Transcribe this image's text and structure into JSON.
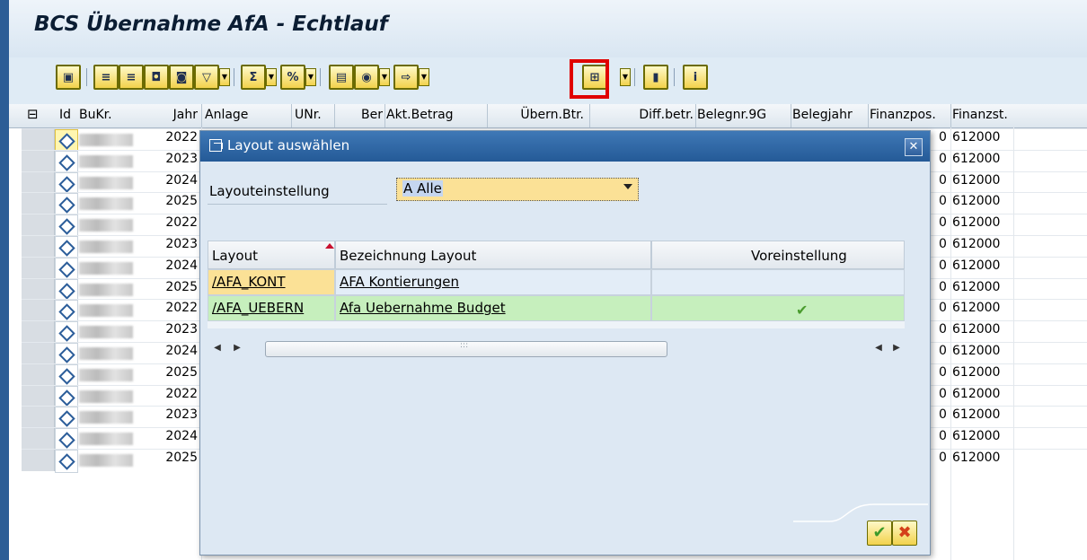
{
  "window": {
    "title": "BCS Übernahme AfA - Echtlauf"
  },
  "toolbar": {
    "icons": [
      "details-icon",
      "sort-asc-icon",
      "sort-desc-icon",
      "find-icon",
      "find-next-icon",
      "filter-icon",
      "sum-icon",
      "subtotal-icon",
      "print-icon",
      "views-icon",
      "export-icon",
      "layout-icon",
      "graphic-icon",
      "info-icon"
    ]
  },
  "grid": {
    "headers": {
      "id": "Id",
      "bukr": "BuKr.",
      "jahr": "Jahr",
      "anlage": "Anlage",
      "unr": "UNr.",
      "ber": "Ber",
      "akt": "Akt.Betrag",
      "uebern": "Übern.Btr.",
      "diff": "Diff.betr.",
      "belegnr": "Belegnr.9G",
      "belegjahr": "Belegjahr",
      "finanzpos": "Finanzpos.",
      "finanzst": "Finanzst."
    },
    "rows": [
      {
        "jahr": "2022",
        "pos_tail": "0",
        "finanzst": "612000"
      },
      {
        "jahr": "2023",
        "pos_tail": "0",
        "finanzst": "612000"
      },
      {
        "jahr": "2024",
        "pos_tail": "0",
        "finanzst": "612000"
      },
      {
        "jahr": "2025",
        "pos_tail": "0",
        "finanzst": "612000"
      },
      {
        "jahr": "2022",
        "pos_tail": "0",
        "finanzst": "612000"
      },
      {
        "jahr": "2023",
        "pos_tail": "0",
        "finanzst": "612000"
      },
      {
        "jahr": "2024",
        "pos_tail": "0",
        "finanzst": "612000"
      },
      {
        "jahr": "2025",
        "pos_tail": "0",
        "finanzst": "612000"
      },
      {
        "jahr": "2022",
        "pos_tail": "0",
        "finanzst": "612000"
      },
      {
        "jahr": "2023",
        "pos_tail": "0",
        "finanzst": "612000"
      },
      {
        "jahr": "2024",
        "pos_tail": "0",
        "finanzst": "612000"
      },
      {
        "jahr": "2025",
        "pos_tail": "0",
        "finanzst": "612000"
      },
      {
        "jahr": "2022",
        "pos_tail": "0",
        "finanzst": "612000"
      },
      {
        "jahr": "2023",
        "pos_tail": "0",
        "finanzst": "612000"
      },
      {
        "jahr": "2024",
        "pos_tail": "0",
        "finanzst": "612000"
      },
      {
        "jahr": "2025",
        "pos_tail": "0",
        "finanzst": "612000"
      }
    ]
  },
  "dialog": {
    "title": "Layout auswählen",
    "setting_label": "Layouteinstellung",
    "setting_value": "A Alle",
    "table": {
      "headers": {
        "layout": "Layout",
        "bezeichnung": "Bezeichnung Layout",
        "vorein": "Voreinstellung"
      },
      "rows": [
        {
          "layout": "/AFA_KONT",
          "bezeichnung": "AFA Kontierungen",
          "default": false
        },
        {
          "layout": "/AFA_UEBERN",
          "bezeichnung": "Afa Uebernahme Budget",
          "default": true
        }
      ]
    },
    "ok_icon": "check-icon",
    "cancel_icon": "cancel-icon"
  },
  "colors": {
    "title_bar": "#2c5d96",
    "highlight_row": "#c6efbd",
    "selected_cell": "#fbe196",
    "red_frame": "#e00000"
  }
}
